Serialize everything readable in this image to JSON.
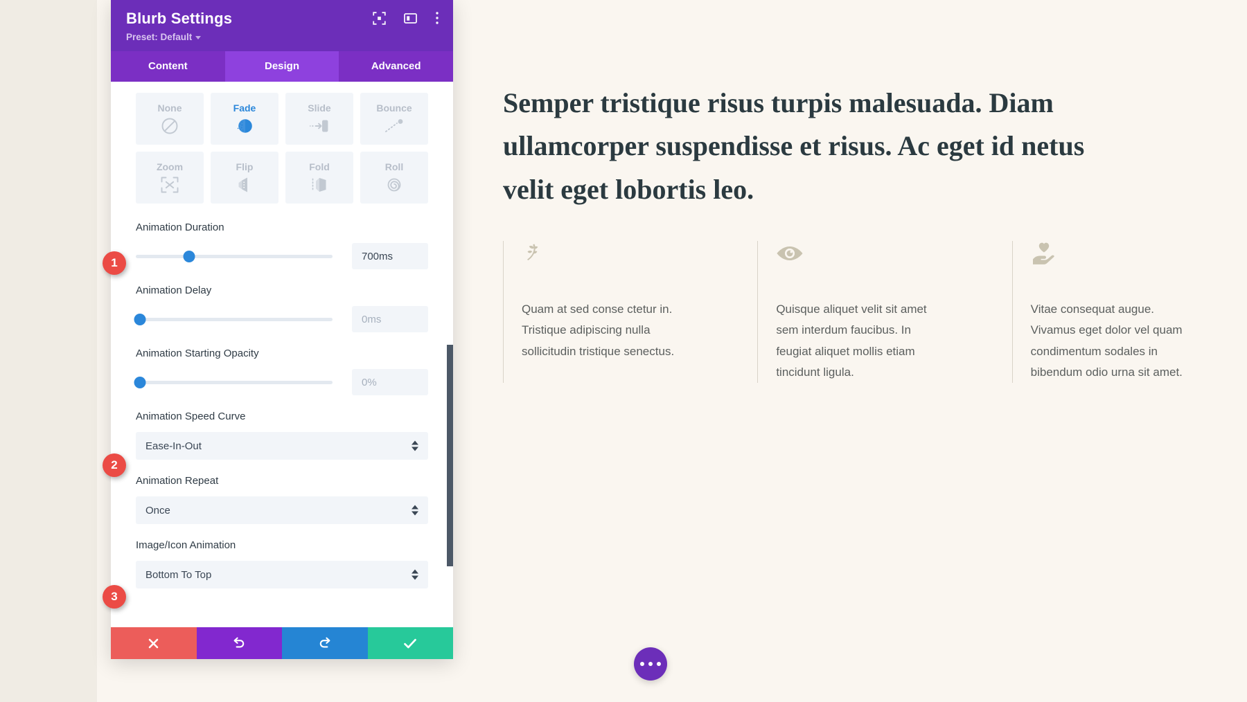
{
  "modal": {
    "title": "Blurb Settings",
    "preset_label": "Preset: Default",
    "header_icons": [
      {
        "name": "focus-icon"
      },
      {
        "name": "layout-panel-icon"
      },
      {
        "name": "more-vertical-icon"
      }
    ],
    "tabs": [
      {
        "label": "Content",
        "active": false
      },
      {
        "label": "Design",
        "active": true
      },
      {
        "label": "Advanced",
        "active": false
      }
    ],
    "animation_styles": [
      {
        "label": "None",
        "icon": "no-entry-icon",
        "selected": false
      },
      {
        "label": "Fade",
        "icon": "fade-icon",
        "selected": true
      },
      {
        "label": "Slide",
        "icon": "slide-icon",
        "selected": false
      },
      {
        "label": "Bounce",
        "icon": "bounce-icon",
        "selected": false
      },
      {
        "label": "Zoom",
        "icon": "zoom-icon",
        "selected": false
      },
      {
        "label": "Flip",
        "icon": "flip-icon",
        "selected": false
      },
      {
        "label": "Fold",
        "icon": "fold-icon",
        "selected": false
      },
      {
        "label": "Roll",
        "icon": "roll-icon",
        "selected": false
      }
    ],
    "fields": {
      "duration": {
        "label": "Animation Duration",
        "value": "700ms",
        "slider_percent": 27,
        "muted": false
      },
      "delay": {
        "label": "Animation Delay",
        "value": "0ms",
        "slider_percent": 0,
        "muted": true
      },
      "starting_opacity": {
        "label": "Animation Starting Opacity",
        "value": "0%",
        "slider_percent": 0,
        "muted": true
      },
      "speed_curve": {
        "label": "Animation Speed Curve",
        "value": "Ease-In-Out"
      },
      "repeat": {
        "label": "Animation Repeat",
        "value": "Once"
      },
      "image_icon_animation": {
        "label": "Image/Icon Animation",
        "value": "Bottom To Top"
      }
    },
    "actions": [
      {
        "name": "cancel-button",
        "icon": "x-icon",
        "color": "#ec5d5a"
      },
      {
        "name": "undo-button",
        "icon": "undo-icon",
        "color": "#8228cf"
      },
      {
        "name": "redo-button",
        "icon": "redo-icon",
        "color": "#2585d4"
      },
      {
        "name": "save-button",
        "icon": "check-icon",
        "color": "#27c99a"
      }
    ]
  },
  "step_badges": [
    {
      "number": "1"
    },
    {
      "number": "2"
    },
    {
      "number": "3"
    }
  ],
  "page": {
    "heading": "Semper tristique risus turpis malesuada. Diam ullamcorper suspendisse et risus. Ac eget id netus velit eget lobortis leo.",
    "blurbs": [
      {
        "icon": "leaf-branch-icon",
        "text": "Quam at sed conse ctetur in. Tristique adipiscing nulla sollicitudin tristique senectus."
      },
      {
        "icon": "eye-icon",
        "text": "Quisque aliquet velit sit amet sem interdum faucibus. In feugiat aliquet mollis etiam tincidunt ligula."
      },
      {
        "icon": "heart-in-hand-icon",
        "text": "Vitae consequat augue. Vivamus eget dolor vel quam condimentum sodales in bibendum odio urna sit amet."
      }
    ],
    "fab": {
      "name": "more-options-fab",
      "icon": "ellipsis-icon"
    }
  },
  "colors": {
    "modal_header": "#6c2eb9",
    "tab_bar": "#7b2fc4",
    "tab_active": "#8e41de",
    "accent_blue": "#2b87da",
    "badge_red": "#eb4b45",
    "page_bg": "#faf6f0"
  }
}
